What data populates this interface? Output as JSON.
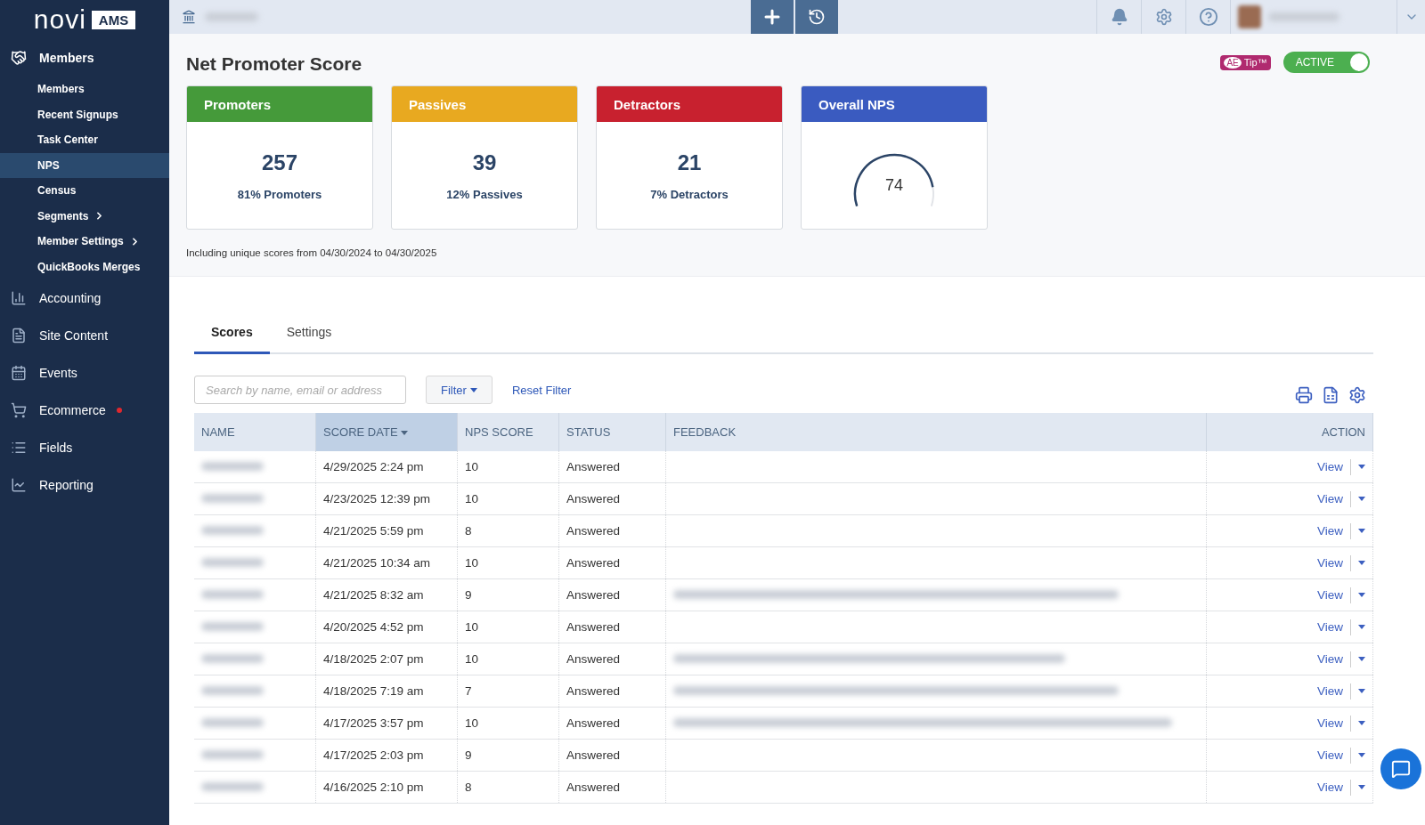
{
  "logo": {
    "word": "novi",
    "badge": "AMS"
  },
  "sidebar": {
    "sections": [
      {
        "label": "Members",
        "expanded": true,
        "dot": false,
        "children": [
          {
            "label": "Members",
            "selected": false,
            "submenu": false
          },
          {
            "label": "Recent Signups",
            "selected": false,
            "submenu": false
          },
          {
            "label": "Task Center",
            "selected": false,
            "submenu": false
          },
          {
            "label": "NPS",
            "selected": true,
            "submenu": false
          },
          {
            "label": "Census",
            "selected": false,
            "submenu": false
          },
          {
            "label": "Segments",
            "selected": false,
            "submenu": true
          },
          {
            "label": "Member Settings",
            "selected": false,
            "submenu": true
          },
          {
            "label": "QuickBooks Merges",
            "selected": false,
            "submenu": false
          }
        ]
      },
      {
        "label": "Accounting",
        "expanded": false,
        "dot": false
      },
      {
        "label": "Site Content",
        "expanded": false,
        "dot": false
      },
      {
        "label": "Events",
        "expanded": false,
        "dot": false
      },
      {
        "label": "Ecommerce",
        "expanded": false,
        "dot": true
      },
      {
        "label": "Fields",
        "expanded": false,
        "dot": false
      },
      {
        "label": "Reporting",
        "expanded": false,
        "dot": false
      }
    ]
  },
  "page": {
    "title": "Net Promoter Score",
    "tip_badge": {
      "mark": "AE",
      "label": "Tip™"
    },
    "active_toggle": {
      "label": "ACTIVE",
      "on": true
    }
  },
  "cards": [
    {
      "title": "Promoters",
      "kind": "count",
      "color": "#459a3a",
      "value": "257",
      "caption": "81% Promoters"
    },
    {
      "title": "Passives",
      "kind": "count",
      "color": "#e8a920",
      "value": "39",
      "caption": "12% Passives"
    },
    {
      "title": "Detractors",
      "kind": "count",
      "color": "#c8212f",
      "value": "21",
      "caption": "7% Detractors"
    },
    {
      "title": "Overall NPS",
      "kind": "gauge",
      "color": "#3a5bc0",
      "value": "74",
      "level": 0.87
    }
  ],
  "date_note": "Including unique scores from 04/30/2024 to 04/30/2025",
  "tabs": [
    {
      "label": "Scores",
      "selected": true
    },
    {
      "label": "Settings",
      "selected": false
    }
  ],
  "search": {
    "placeholder": "Search by name, email or address"
  },
  "filter_button": "Filter",
  "reset_link": "Reset Filter",
  "table": {
    "columns": [
      {
        "label": "NAME",
        "sorted": false
      },
      {
        "label": "SCORE DATE",
        "sorted": true
      },
      {
        "label": "NPS SCORE",
        "sorted": false
      },
      {
        "label": "STATUS",
        "sorted": false
      },
      {
        "label": "FEEDBACK",
        "sorted": false
      },
      {
        "label": "ACTION",
        "sorted": false
      }
    ],
    "rows": [
      {
        "date": "4/29/2025 2:24 pm",
        "score": "10",
        "status": "Answered",
        "feedback_hidden": false,
        "action": "View"
      },
      {
        "date": "4/23/2025 12:39 pm",
        "score": "10",
        "status": "Answered",
        "feedback_hidden": false,
        "action": "View"
      },
      {
        "date": "4/21/2025 5:59 pm",
        "score": "8",
        "status": "Answered",
        "feedback_hidden": false,
        "action": "View"
      },
      {
        "date": "4/21/2025 10:34 am",
        "score": "10",
        "status": "Answered",
        "feedback_hidden": false,
        "action": "View"
      },
      {
        "date": "4/21/2025 8:32 am",
        "score": "9",
        "status": "Answered",
        "feedback_hidden": true,
        "action": "View"
      },
      {
        "date": "4/20/2025 4:52 pm",
        "score": "10",
        "status": "Answered",
        "feedback_hidden": false,
        "action": "View"
      },
      {
        "date": "4/18/2025 2:07 pm",
        "score": "10",
        "status": "Answered",
        "feedback_hidden": true,
        "action": "View"
      },
      {
        "date": "4/18/2025 7:19 am",
        "score": "7",
        "status": "Answered",
        "feedback_hidden": true,
        "action": "View"
      },
      {
        "date": "4/17/2025 3:57 pm",
        "score": "10",
        "status": "Answered",
        "feedback_hidden": true,
        "action": "View"
      },
      {
        "date": "4/17/2025 2:03 pm",
        "score": "9",
        "status": "Answered",
        "feedback_hidden": false,
        "action": "View"
      },
      {
        "date": "4/16/2025 2:10 pm",
        "score": "8",
        "status": "Answered",
        "feedback_hidden": false,
        "action": "View"
      }
    ]
  }
}
